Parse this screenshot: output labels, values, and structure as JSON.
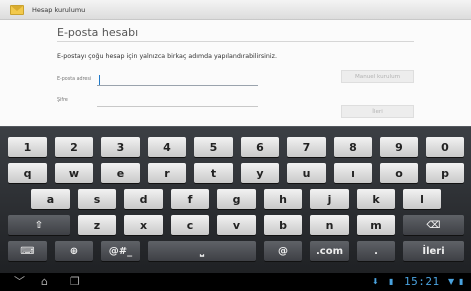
{
  "actionbar": {
    "title": "Hesap kurulumu",
    "icon": "envelope-icon"
  },
  "form": {
    "heading": "E-posta hesabı",
    "description": "E-postayı çoğu hesap için yalnızca birkaç adımda yapılandırabilirsiniz.",
    "email_label": "E-posta adresi",
    "email_value": "",
    "password_label": "Şifre",
    "password_value": "",
    "manual_button": "Manuel kurulum",
    "next_button": "İleri"
  },
  "keyboard": {
    "row_numbers": [
      "1",
      "2",
      "3",
      "4",
      "5",
      "6",
      "7",
      "8",
      "9",
      "0"
    ],
    "row_top": [
      "q",
      "w",
      "e",
      "r",
      "t",
      "y",
      "u",
      "ı",
      "o",
      "p"
    ],
    "row_home": [
      "a",
      "s",
      "d",
      "f",
      "g",
      "h",
      "j",
      "k",
      "l"
    ],
    "row_bottom": [
      "z",
      "x",
      "c",
      "v",
      "b",
      "n",
      "m"
    ],
    "shift_icon": "shift-icon",
    "backspace_icon": "backspace-icon",
    "settings_icon": "keyboard-settings-icon",
    "globe_icon": "globe-icon",
    "symbols_label": "@#_",
    "space_icon": "space-icon",
    "at_label": "@",
    "dotcom_label": ".com",
    "period_label": ".",
    "enter_label": "İleri"
  },
  "navbar": {
    "back_icon": "back-icon",
    "home_icon": "home-icon",
    "recent_icon": "recent-apps-icon",
    "time": "15:21",
    "notification_icon": "download-icon",
    "sd_icon": "sd-card-icon",
    "wifi_icon": "wifi-icon",
    "battery_icon": "battery-icon"
  },
  "colors": {
    "accent": "#4aa3df",
    "keyboard_bg": "#2b2d31",
    "key_light": "#e6e6e6",
    "key_dark": "#4a4d52"
  }
}
